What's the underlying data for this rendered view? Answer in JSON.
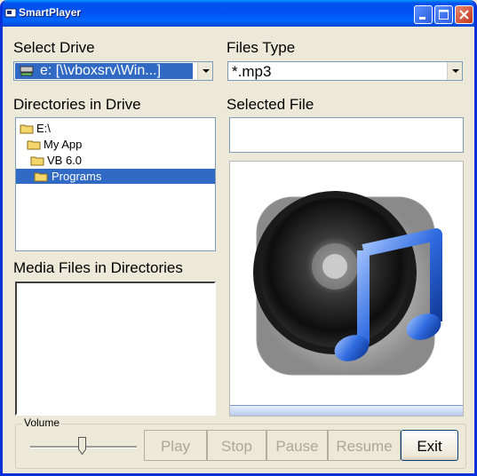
{
  "window": {
    "title": "SmartPlayer"
  },
  "labels": {
    "select_drive": "Select Drive",
    "files_type": "Files Type",
    "directories": "Directories in Drive",
    "selected_file": "Selected File",
    "media_files": "Media Files in Directories",
    "volume": "Volume"
  },
  "drive_combo": {
    "value": "e: [\\\\vboxsrv\\Win...]"
  },
  "files_type_combo": {
    "value": "*.mp3"
  },
  "selected_file": {
    "value": ""
  },
  "directory_tree": [
    {
      "label": "E:\\"
    },
    {
      "label": "My App"
    },
    {
      "label": "VB 6.0"
    },
    {
      "label": "Programs",
      "selected": true
    }
  ],
  "volume": {
    "level": 0.5
  },
  "buttons": {
    "play": "Play",
    "stop": "Stop",
    "pause": "Pause",
    "resume": "Resume",
    "exit": "Exit"
  },
  "colors": {
    "selection": "#316ac5",
    "titlebar": "#0054e3",
    "window_bg": "#ece9d8"
  }
}
